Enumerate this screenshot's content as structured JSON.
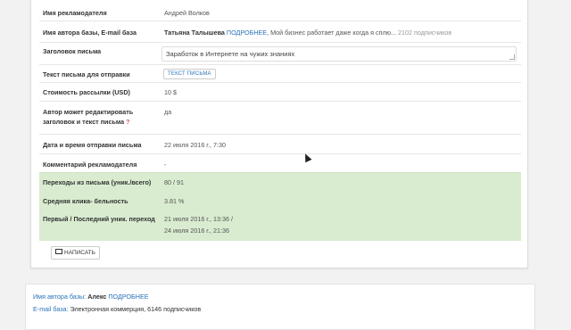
{
  "details": {
    "advertiser": {
      "label": "Имя рекламодателя",
      "value": "Андрей Волков"
    },
    "author": {
      "label": "Имя автора базы, E-mail база",
      "name": "Татьяна Талышева",
      "more_link": "ПОДРОБНЕЕ",
      "base_text": ", Мой бизнес работает даже когда я сплю...",
      "subscribers": "2102 подписчиков"
    },
    "subject": {
      "label": "Заголовок письма",
      "value": "Заработок в Интернете на чужих знаниях"
    },
    "letter_text": {
      "label": "Текст письма для отправки",
      "button": "ТЕКСТ ПИСЬМА"
    },
    "cost": {
      "label": "Стоимость рассылки (USD)",
      "value": "10 $"
    },
    "editable": {
      "label_line1": "Автор может редактировать",
      "label_line2": "заголовок и текст письма",
      "qmark": "?",
      "value": "да"
    },
    "send_date": {
      "label": "Дата и время отправки письма",
      "value": "22 июля 2016 г., 7:30"
    },
    "comment": {
      "label": "Комментарий рекламодателя",
      "value": "-"
    },
    "clicks": {
      "label": "Переходы из письма (уник./всего)",
      "value": "80 / 91"
    },
    "ctr": {
      "label": "Средняя клика- бельность",
      "value": "3.81 %"
    },
    "first_last": {
      "label": "Первый / Последний уник. переход",
      "first": "21 июля 2016 г., 13:36 /",
      "last": "24 июля 2016 г., 21:36"
    }
  },
  "write_button": "НАПИСАТЬ",
  "next_entry": {
    "author_label": "Имя автора базы:",
    "author_name": "Алекс",
    "more_link": "ПОДРОБНЕЕ",
    "email_label": "E-mail база:",
    "email_value": "Электронная коммерция, 6146 подписчиков"
  }
}
